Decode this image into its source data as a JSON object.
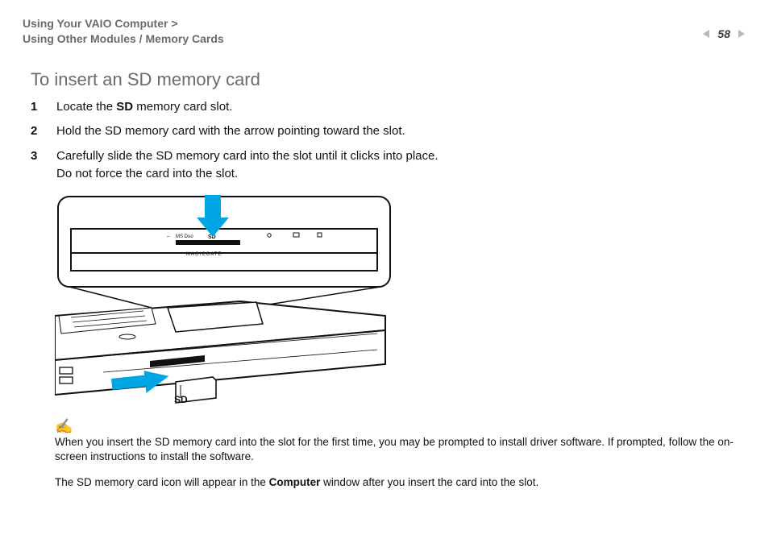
{
  "header": {
    "breadcrumb_line1": "Using Your VAIO Computer",
    "breadcrumb_line2": "Using Other Modules / Memory Cards",
    "page_number": "58"
  },
  "section": {
    "title": "To insert an SD memory card",
    "steps": [
      {
        "n": "1",
        "prefix": "Locate the ",
        "bold": "SD",
        "suffix": " memory card slot."
      },
      {
        "n": "2",
        "prefix": "Hold the SD memory card with the arrow pointing toward the slot.",
        "bold": "",
        "suffix": ""
      },
      {
        "n": "3",
        "prefix": "Carefully slide the SD memory card into the slot until it clicks into place.",
        "bold": "",
        "suffix": "",
        "line2": "Do not force the card into the slot."
      }
    ]
  },
  "illustration": {
    "callout_top_label": "SD",
    "side_label_msduo": "MS Duo",
    "side_label_magicgate": "MAGICGATE",
    "callout_bottom_label": "SD"
  },
  "notes": {
    "note1_prefix": "When you insert the SD memory card into the slot for the first time, you may be prompted to install driver software. If prompted, follow the on-screen instructions to install the software.",
    "note2_prefix": "The SD memory card icon will appear in the ",
    "note2_bold": "Computer",
    "note2_suffix": " window after you insert the card into the slot."
  }
}
